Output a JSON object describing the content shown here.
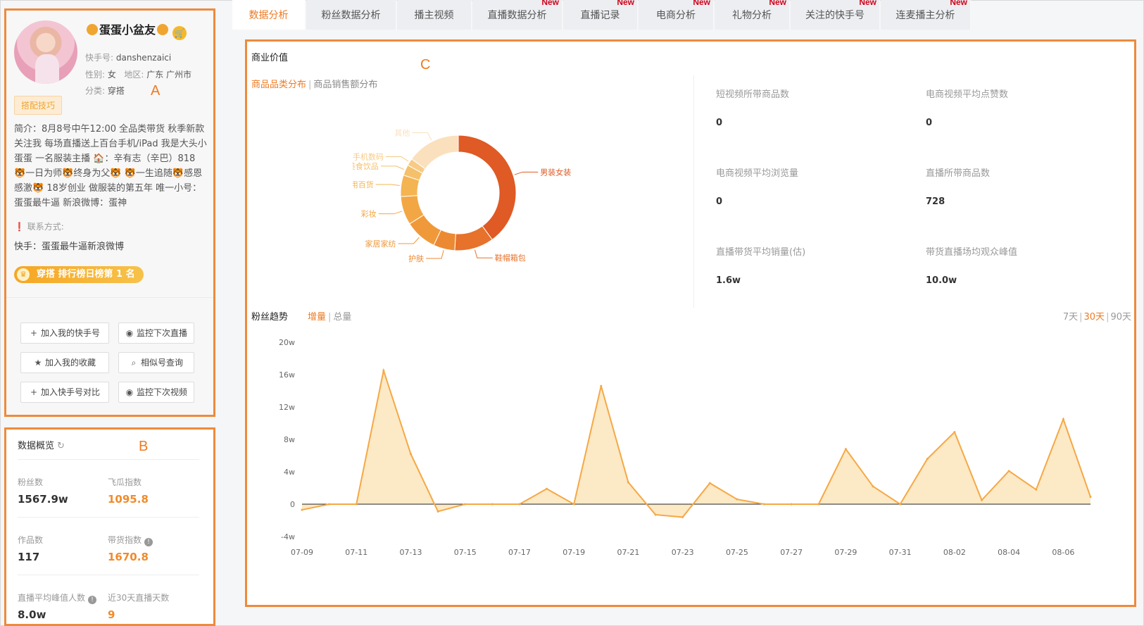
{
  "box_letters": {
    "a": "A",
    "b": "B",
    "c": "C"
  },
  "profile": {
    "nickname": "蛋蛋小盆友",
    "kuaishou_id_label": "快手号:",
    "kuaishou_id": "danshenzaici",
    "gender_label": "性别:",
    "gender": "女",
    "region_label": "地区:",
    "region": "广东 广州市",
    "category_label": "分类:",
    "category": "穿搭",
    "tip_tag": "搭配技巧",
    "bio": "简介：8月8号中午12:00 全品类带货 秋季新款 关注我 每场直播送上百台手机/iPad 我是大头小蛋蛋 一名服装主播 🏠：辛有志（辛巴）818 🐯一日为师🐯终身为父🐯 🐯一生追随🐯感恩感激🐯 18岁创业 做服装的第五年 唯一小号：蛋蛋最牛逼 新浪微博：蛋神",
    "contact_title": "联系方式:",
    "contact": "快手：蛋蛋最牛逼新浪微博",
    "rank": "穿搭 排行榜日榜第 1 名"
  },
  "actions": {
    "add_my_kuaishou": "加入我的快手号",
    "monitor_next_live": "监控下次直播",
    "add_favorite": "加入我的收藏",
    "similar_search": "相似号查询",
    "add_compare": "加入快手号对比",
    "monitor_next_video": "监控下次视频"
  },
  "overview": {
    "title": "数据概览",
    "fans_label": "粉丝数",
    "fans": "1567.9w",
    "feigua_label": "飞瓜指数",
    "feigua": "1095.8",
    "works_label": "作品数",
    "works": "117",
    "sales_index_label": "带货指数",
    "sales_index": "1670.8",
    "live_peak_label": "直播平均峰值人数",
    "live_peak": "8.0w",
    "live_days_label": "近30天直播天数",
    "live_days": "9"
  },
  "tabs": [
    {
      "label": "数据分析",
      "new": ""
    },
    {
      "label": "粉丝数据分析",
      "new": ""
    },
    {
      "label": "播主视频",
      "new": ""
    },
    {
      "label": "直播数据分析",
      "new": "New"
    },
    {
      "label": "直播记录",
      "new": "New"
    },
    {
      "label": "电商分析",
      "new": "New"
    },
    {
      "label": "礼物分析",
      "new": "New"
    },
    {
      "label": "关注的快手号",
      "new": "New"
    },
    {
      "label": "连麦播主分析",
      "new": "New"
    }
  ],
  "commercial": {
    "title": "商业价值",
    "subtab_category": "商品品类分布",
    "subtab_sales": "商品销售额分布",
    "stats": {
      "short_video_goods_label": "短视频所带商品数",
      "short_video_goods": "0",
      "ecom_video_likes_label": "电商视频平均点赞数",
      "ecom_video_likes": "0",
      "ecom_video_views_label": "电商视频平均浏览量",
      "ecom_video_views": "0",
      "live_goods_label": "直播所带商品数",
      "live_goods": "728",
      "live_avg_sales_label": "直播带货平均销量(估)",
      "live_avg_sales": "1.6w",
      "live_peak_viewers_label": "带货直播场均观众峰值",
      "live_peak_viewers": "10.0w"
    }
  },
  "donut_data": {
    "type": "pie",
    "slices": [
      {
        "label": "男装女装",
        "value": 40,
        "color": "#df5a24"
      },
      {
        "label": "鞋帽箱包",
        "value": 11,
        "color": "#e6722c"
      },
      {
        "label": "护肤",
        "value": 6,
        "color": "#ec8a33"
      },
      {
        "label": "家居家纺",
        "value": 9,
        "color": "#f0993a"
      },
      {
        "label": "彩妆",
        "value": 8,
        "color": "#f2a744"
      },
      {
        "label": "日用百货",
        "value": 6,
        "color": "#f4b452"
      },
      {
        "label": "美食饮品",
        "value": 3,
        "color": "#f5c06a"
      },
      {
        "label": "手机数码",
        "value": 2,
        "color": "#f7cb85"
      },
      {
        "label": "其他",
        "value": 15,
        "color": "#fbe0bd"
      }
    ]
  },
  "trend": {
    "title": "粉丝趋势",
    "tab_increase": "增量",
    "tab_total": "总量",
    "range_7": "7天",
    "range_30": "30天",
    "range_90": "90天"
  },
  "chart_data": {
    "type": "area",
    "title": "",
    "xlabel": "",
    "ylabel": "",
    "ylim": [
      -4,
      20
    ],
    "yticks": [
      -4,
      0,
      4,
      8,
      12,
      16,
      20
    ],
    "ytick_labels": [
      "-4w",
      "0",
      "4w",
      "8w",
      "12w",
      "16w",
      "20w"
    ],
    "x": [
      "07-09",
      "07-10",
      "07-11",
      "07-12",
      "07-13",
      "07-14",
      "07-15",
      "07-16",
      "07-17",
      "07-18",
      "07-19",
      "07-20",
      "07-21",
      "07-22",
      "07-23",
      "07-24",
      "07-25",
      "07-26",
      "07-27",
      "07-28",
      "07-29",
      "07-30",
      "07-31",
      "08-01",
      "08-02",
      "08-03",
      "08-04",
      "08-05",
      "08-06",
      "08-07"
    ],
    "xtick_labels": [
      "07-09",
      "07-11",
      "07-13",
      "07-15",
      "07-17",
      "07-19",
      "07-21",
      "07-23",
      "07-25",
      "07-27",
      "07-29",
      "07-31",
      "08-02",
      "08-04",
      "08-06"
    ],
    "series": [
      {
        "name": "",
        "color": "#f5a845",
        "fill": "#fce9c6",
        "values": [
          -0.7,
          0,
          0,
          16.5,
          6.2,
          -0.9,
          0,
          0,
          0,
          1.9,
          0,
          14.6,
          2.7,
          -1.3,
          -1.6,
          2.6,
          0.6,
          0,
          0,
          0,
          6.8,
          2.2,
          0,
          5.6,
          8.9,
          0.5,
          4.1,
          1.8,
          10.5,
          0.9
        ]
      }
    ]
  }
}
